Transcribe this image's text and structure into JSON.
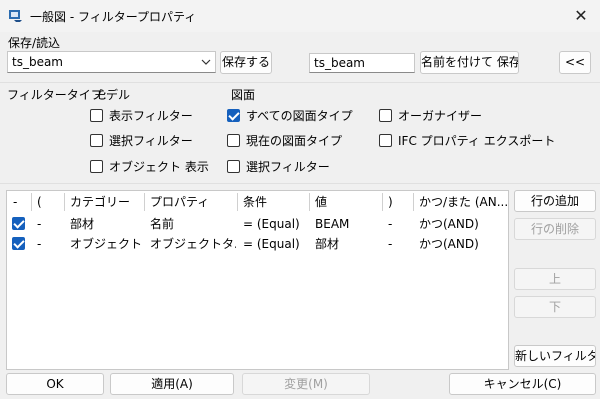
{
  "window": {
    "title": "一般図 - フィルタープロパティ",
    "close_glyph": "✕",
    "icon": "filter-app-icon"
  },
  "save_load": {
    "group_label": "保存/読込",
    "preset_value": "ts_beam",
    "save_button": "保存する",
    "name_value": "ts_beam",
    "save_as_button": "名前を付けて 保存",
    "collapse_button": "<<"
  },
  "filter_type": {
    "label": "フィルタータイプ:",
    "model_label": "モデル",
    "drawing_label": "図面",
    "options": [
      {
        "label": "表示フィルター",
        "checked": false
      },
      {
        "label": "選択フィルター",
        "checked": false
      },
      {
        "label": "オブジェクト 表示",
        "checked": false
      },
      {
        "label": "すべての図面タイプ",
        "checked": true
      },
      {
        "label": "現在の図面タイプ",
        "checked": false
      },
      {
        "label": "選択フィルター",
        "checked": false
      },
      {
        "label": "オーガナイザー",
        "checked": false
      },
      {
        "label": "IFC プロパティ エクスポート",
        "checked": false
      }
    ]
  },
  "grid": {
    "columns": [
      "-",
      "(",
      "カテゴリー",
      "プロパティ",
      "条件",
      "値",
      ")",
      "かつ/また (AN..."
    ],
    "rows": [
      {
        "checked": true,
        "open": "-",
        "category": "部材",
        "property": "名前",
        "condition": "= (Equal)",
        "value": "BEAM",
        "close": "-",
        "andor": "かつ(AND)"
      },
      {
        "checked": true,
        "open": "-",
        "category": "オブジェクト",
        "property": "オブジェクトタ...",
        "condition": "= (Equal)",
        "value": "部材",
        "close": "-",
        "andor": "かつ(AND)"
      }
    ]
  },
  "side_buttons": {
    "add_row": "行の追加",
    "delete_row": "行の削除",
    "up": "上",
    "down": "下",
    "new_filter": "新しいフィルター"
  },
  "footer": {
    "ok": "OK",
    "apply": "適用(A)",
    "modify": "変更(M)",
    "cancel": "キャンセル(C)"
  }
}
